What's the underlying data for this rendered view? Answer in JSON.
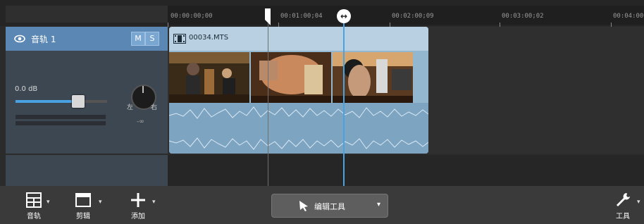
{
  "ruler": {
    "ticks": [
      "00:00:00;00",
      "00:01:00;04",
      "00:02:00;09",
      "00:03:00;02",
      "00:04:00"
    ]
  },
  "track": {
    "name": "音轨 1",
    "mute_label": "M",
    "solo_label": "S",
    "volume_db": "0.0 dB",
    "pan_left": "左",
    "pan_right": "右",
    "pan_value": "-∞"
  },
  "clip": {
    "name": "00034.MTS"
  },
  "toolbar": {
    "tracks_label": "音轨",
    "clip_label": "剪辑",
    "add_label": "添加",
    "edit_tool_label": "编辑工具",
    "tools_label": "工具"
  },
  "colors": {
    "accent": "#4aa3e0",
    "track_header": "#5a87b3",
    "clip": "#94b7d0"
  },
  "volume_level": 0.65
}
